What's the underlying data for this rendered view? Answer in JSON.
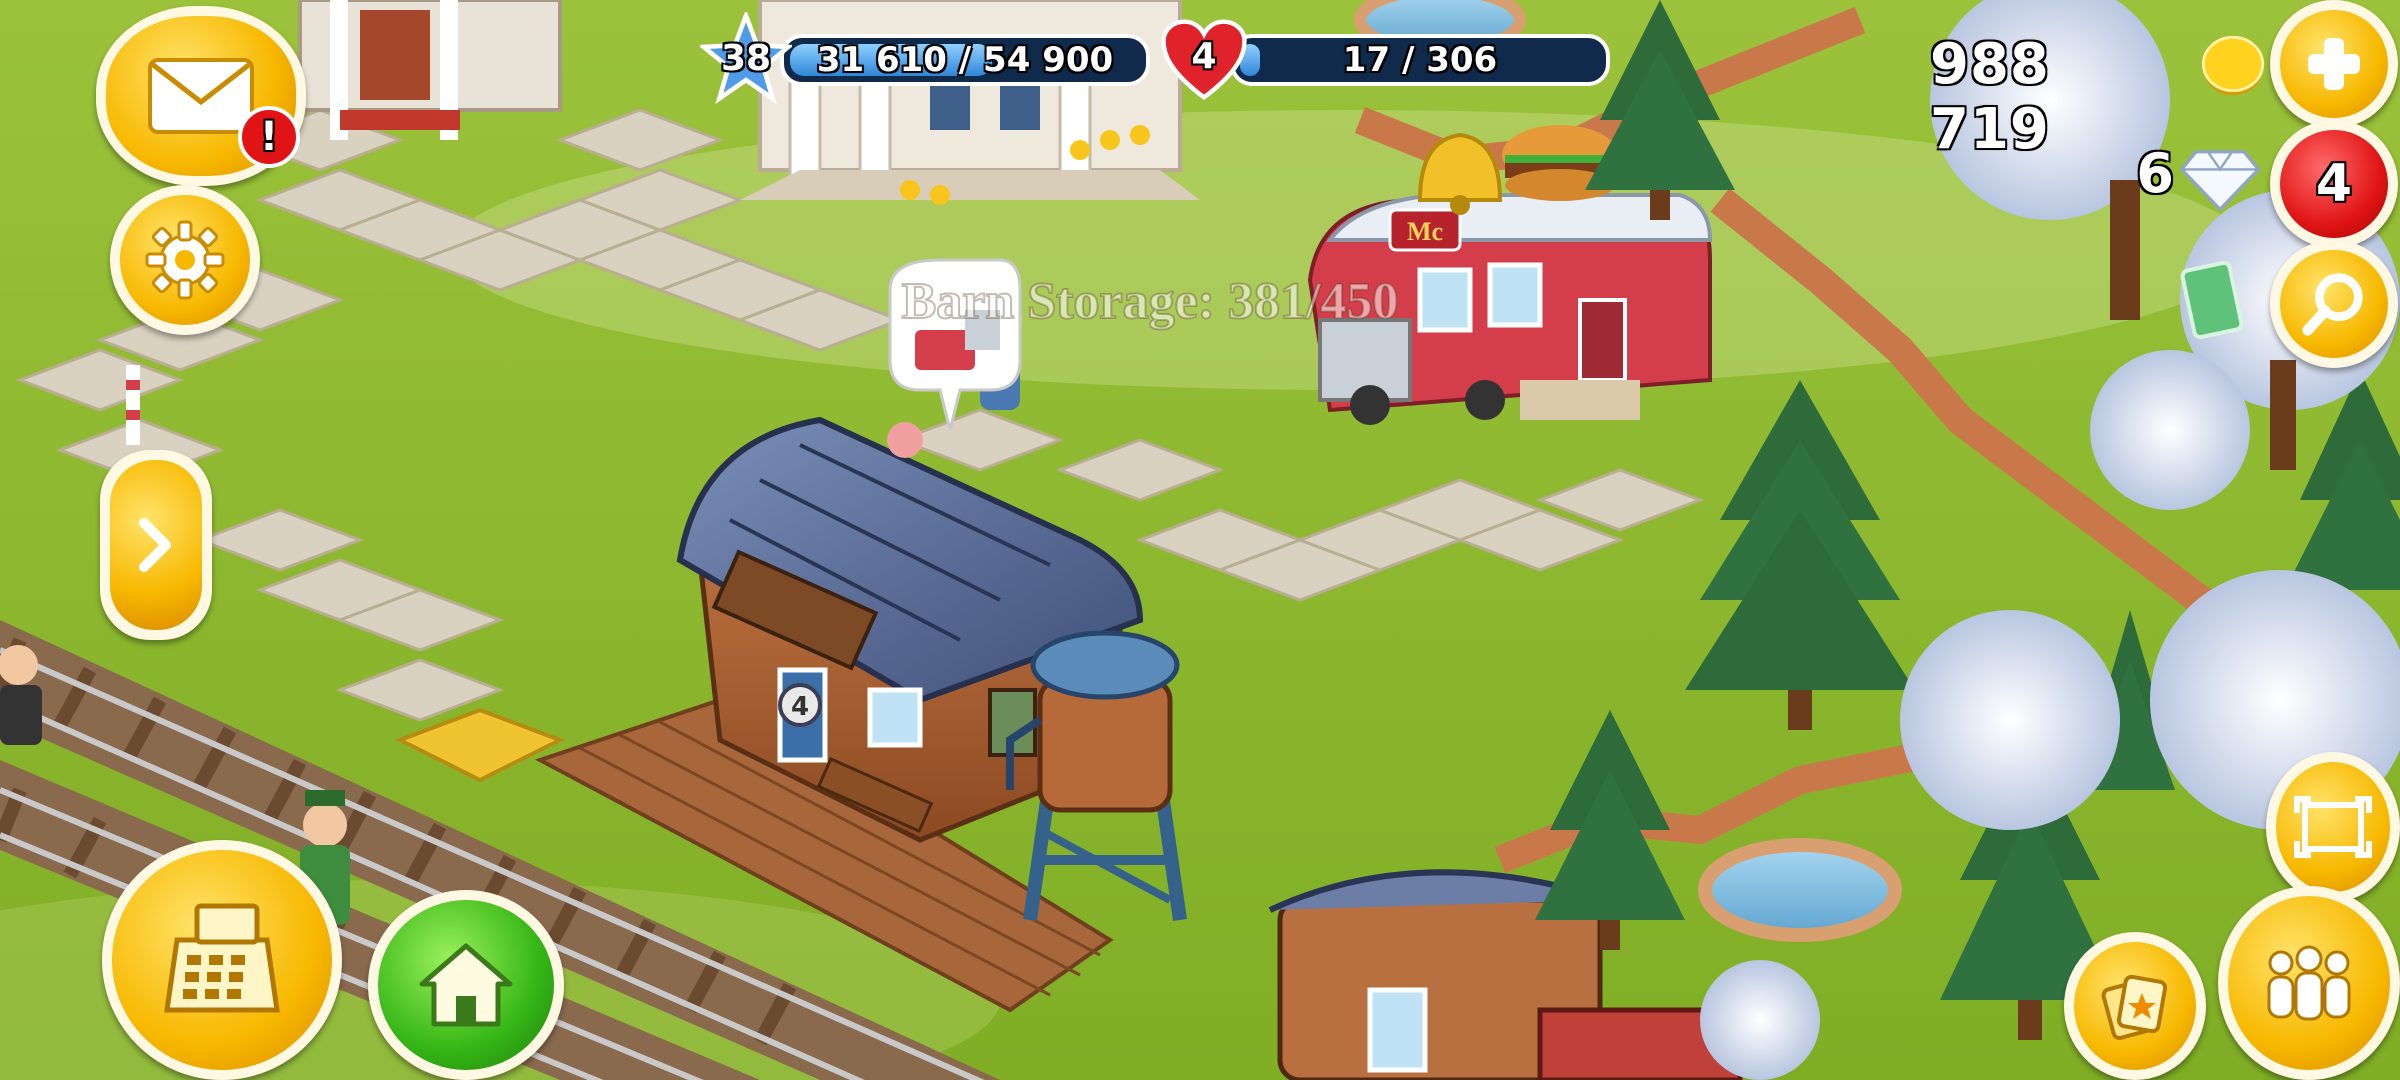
{
  "hud": {
    "level": "38",
    "xp_text": "31 610 / 54 900",
    "xp_fraction": 0.576,
    "hearts": "4",
    "reputation_text": "17 / 306",
    "reputation_fraction": 0.056,
    "coins": "988 719",
    "diamonds": "6",
    "notifications_badge": "4",
    "mail_alert": "!"
  },
  "scene": {
    "floating_text": "Barn Storage: 381/450",
    "station_plate": "4",
    "diner_sign": "Mc"
  },
  "colors": {
    "grass": "#8db52e",
    "coin": "#f5c400",
    "xp_bar": "#2f86d8",
    "alert_red": "#e01414"
  },
  "icons": {
    "mail": "envelope-icon",
    "settings": "gear-icon",
    "expand": "chevron-right-icon",
    "shop": "cash-register-icon",
    "home": "house-icon",
    "add_coins": "plus-icon",
    "search": "magnifier-icon",
    "camera": "resize-arrows-icon",
    "friends": "people-icon",
    "cards": "cards-icon"
  }
}
